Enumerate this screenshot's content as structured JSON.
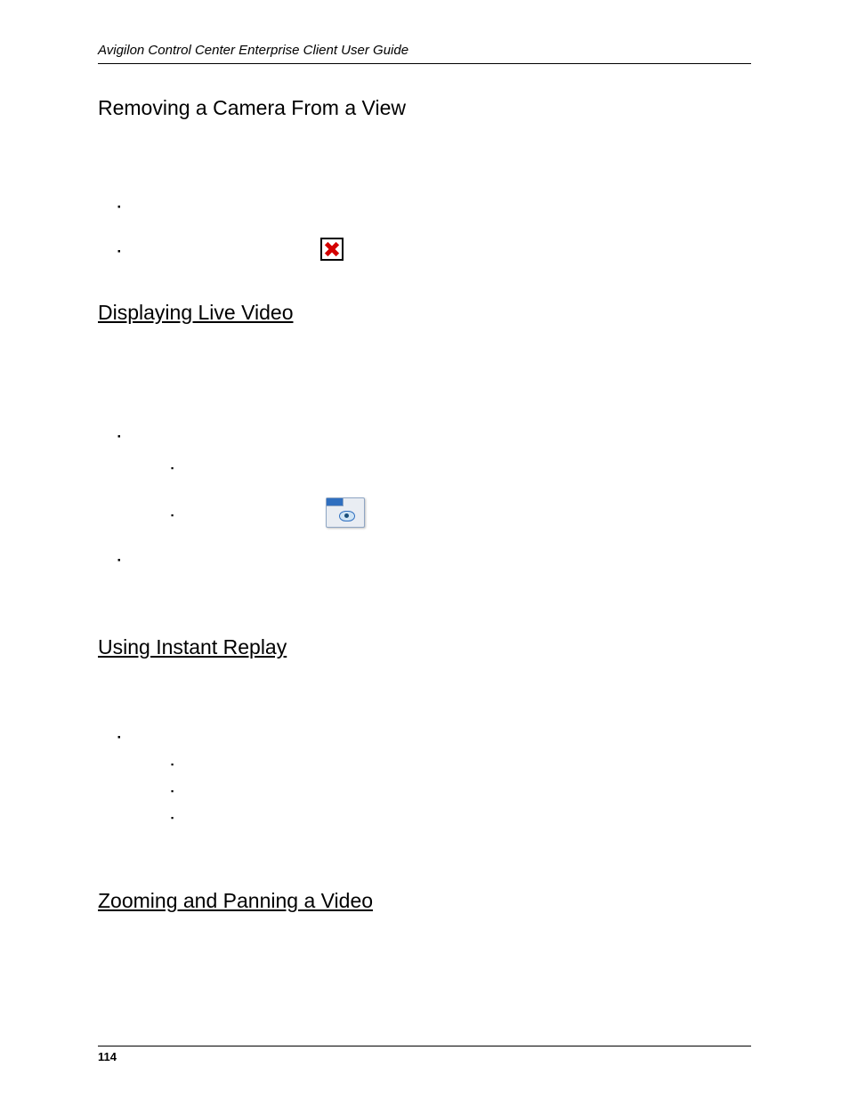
{
  "header": {
    "title": "Avigilon Control Center Enterprise Client User Guide"
  },
  "page": {
    "number": "114"
  },
  "sections": {
    "s1": {
      "heading": "Removing a Camera From a View"
    },
    "s2": {
      "heading": "Displaying Live Video"
    },
    "s3": {
      "heading": "Using Instant Replay"
    },
    "s4": {
      "heading": "Zooming and Panning a Video"
    }
  }
}
